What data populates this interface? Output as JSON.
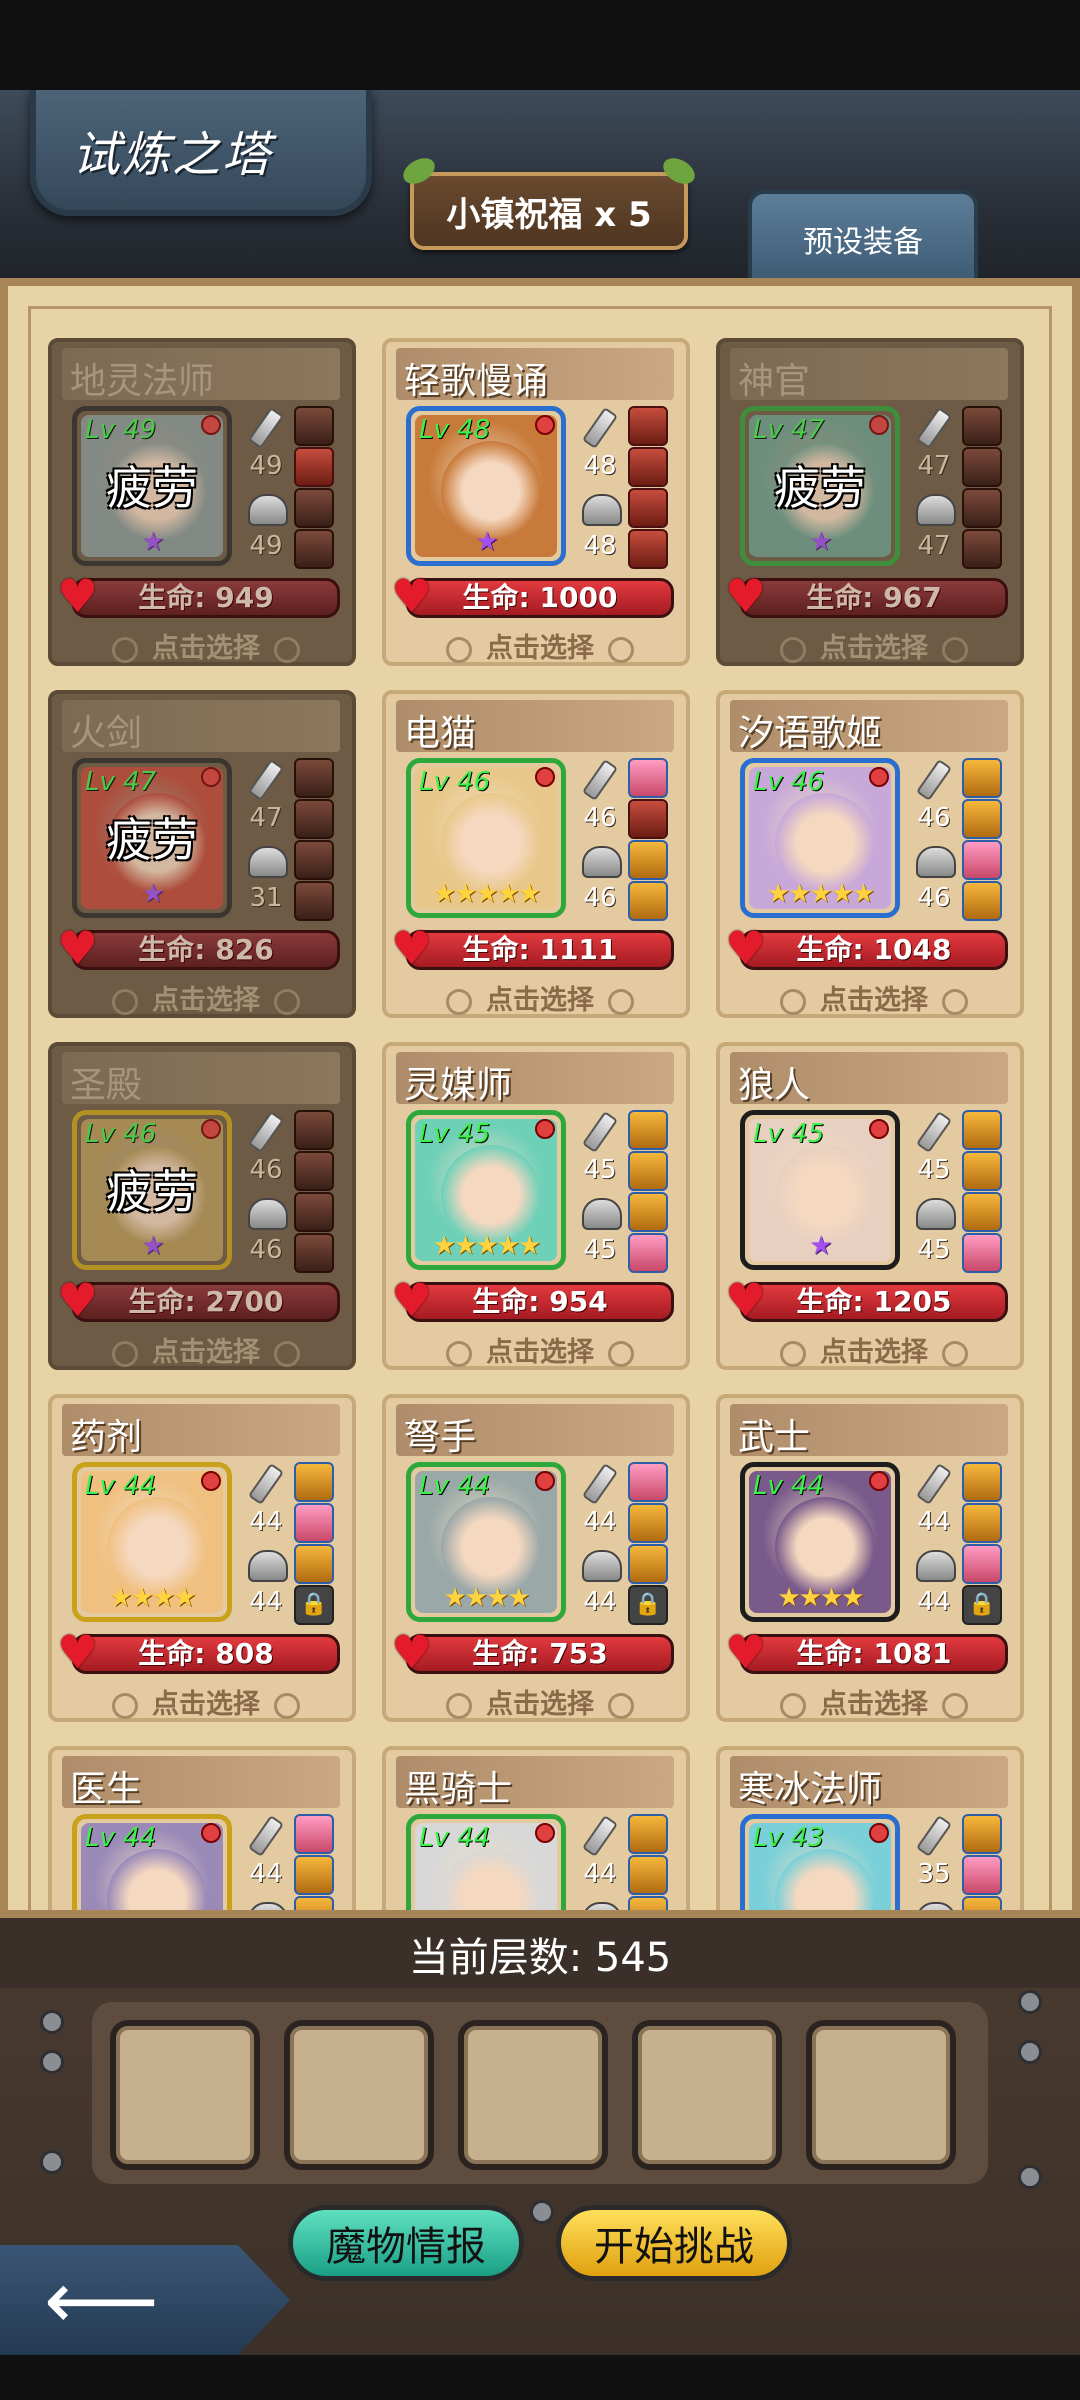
{
  "header": {
    "title": "试炼之塔",
    "blessing": "小镇祝福 x 5",
    "preset_button": "预设装备"
  },
  "tired_label": "疲劳",
  "select_label": "点击选择",
  "heroes": [
    {
      "name": "地灵法师",
      "level": "Lv 49",
      "weapon": "49",
      "armor": "49",
      "hp": "生命: 949",
      "tired": true,
      "stars": 1,
      "star_color": "purple",
      "frame": "#2a2a2a",
      "bg": "#8a9a9a",
      "slots": [
        "dark",
        "red",
        "dark",
        "dark"
      ]
    },
    {
      "name": "轻歌慢诵",
      "level": "Lv 48",
      "weapon": "48",
      "armor": "48",
      "hp": "生命: 1000",
      "tired": false,
      "stars": 1,
      "star_color": "purple",
      "frame": "#2a6fd0",
      "bg": "#c87a3a",
      "slots": [
        "red",
        "red",
        "red",
        "red"
      ]
    },
    {
      "name": "神官",
      "level": "Lv 47",
      "weapon": "47",
      "armor": "47",
      "hp": "生命: 967",
      "tired": true,
      "stars": 1,
      "star_color": "purple",
      "frame": "#2e9f3a",
      "bg": "#6fa090",
      "slots": [
        "dark",
        "dark",
        "dark",
        "dark"
      ]
    },
    {
      "name": "火剑",
      "level": "Lv 47",
      "weapon": "47",
      "armor": "31",
      "hp": "生命: 826",
      "tired": true,
      "stars": 1,
      "star_color": "purple",
      "frame": "#2a2a2a",
      "bg": "#c24a3a",
      "slots": [
        "dark",
        "dark",
        "dark",
        "dark"
      ]
    },
    {
      "name": "电猫",
      "level": "Lv 46",
      "weapon": "46",
      "armor": "46",
      "hp": "生命: 1111",
      "tired": false,
      "stars": 5,
      "star_color": "gold",
      "frame": "#2ea83a",
      "bg": "#e8c88a",
      "slots": [
        "pink",
        "red",
        "gold",
        "gold"
      ]
    },
    {
      "name": "汐语歌姬",
      "level": "Lv 46",
      "weapon": "46",
      "armor": "46",
      "hp": "生命: 1048",
      "tired": false,
      "stars": 5,
      "star_color": "gold",
      "frame": "#2a6fd0",
      "bg": "#c8a8d8",
      "slots": [
        "gold",
        "gold",
        "pink",
        "gold"
      ]
    },
    {
      "name": "圣殿",
      "level": "Lv 46",
      "weapon": "46",
      "armor": "46",
      "hp": "生命: 2700",
      "tired": true,
      "stars": 1,
      "star_color": "purple",
      "frame": "#c9a21a",
      "bg": "#b89a5a",
      "slots": [
        "dark",
        "dark",
        "dark",
        "dark"
      ]
    },
    {
      "name": "灵媒师",
      "level": "Lv 45",
      "weapon": "45",
      "armor": "45",
      "hp": "生命: 954",
      "tired": false,
      "stars": 5,
      "star_color": "gold",
      "frame": "#2ea83a",
      "bg": "#6fd0b8",
      "slots": [
        "gold",
        "gold",
        "gold",
        "pink"
      ]
    },
    {
      "name": "狼人",
      "level": "Lv 45",
      "weapon": "45",
      "armor": "45",
      "hp": "生命: 1205",
      "tired": false,
      "stars": 1,
      "star_color": "purple",
      "frame": "#1d1d1d",
      "bg": "#e8d0c0",
      "slots": [
        "gold",
        "gold",
        "gold",
        "pink"
      ]
    },
    {
      "name": "药剂",
      "level": "Lv 44",
      "weapon": "44",
      "armor": "44",
      "hp": "生命: 808",
      "tired": false,
      "stars": 4,
      "star_color": "gold",
      "frame": "#c9a21a",
      "bg": "#f0c080",
      "slots": [
        "gold",
        "pink",
        "gold",
        "lock"
      ]
    },
    {
      "name": "弩手",
      "level": "Lv 44",
      "weapon": "44",
      "armor": "44",
      "hp": "生命: 753",
      "tired": false,
      "stars": 4,
      "star_color": "gold",
      "frame": "#2ea83a",
      "bg": "#9aa8a8",
      "slots": [
        "pink",
        "gold",
        "gold",
        "lock"
      ]
    },
    {
      "name": "武士",
      "level": "Lv 44",
      "weapon": "44",
      "armor": "44",
      "hp": "生命: 1081",
      "tired": false,
      "stars": 4,
      "star_color": "gold",
      "frame": "#1d1d1d",
      "bg": "#7a5a8a",
      "slots": [
        "gold",
        "gold",
        "pink",
        "lock"
      ]
    },
    {
      "name": "医生",
      "level": "Lv 44",
      "weapon": "44",
      "armor": "",
      "hp": "",
      "tired": false,
      "stars": 0,
      "star_color": "gold",
      "frame": "#c9a21a",
      "bg": "#9a8ab8",
      "slots": [
        "pink",
        "gold",
        "gold"
      ]
    },
    {
      "name": "黑骑士",
      "level": "Lv 44",
      "weapon": "44",
      "armor": "",
      "hp": "",
      "tired": false,
      "stars": 0,
      "star_color": "gold",
      "frame": "#2ea83a",
      "bg": "#d8d8d8",
      "slots": [
        "gold",
        "gold",
        "gold"
      ]
    },
    {
      "name": "寒冰法师",
      "level": "Lv 43",
      "weapon": "35",
      "armor": "",
      "hp": "",
      "tired": false,
      "stars": 0,
      "star_color": "gold",
      "frame": "#2a6fd0",
      "bg": "#7ad0d8",
      "slots": [
        "gold",
        "pink",
        "gold"
      ]
    }
  ],
  "floor": "当前层数: 545",
  "team_slots": 5,
  "buttons": {
    "monster_info": "魔物情报",
    "start": "开始挑战"
  },
  "colors": {
    "hp_red": "#e23a3f",
    "panel_bg": "#e8d3a6",
    "level_green": "#3df04a"
  }
}
